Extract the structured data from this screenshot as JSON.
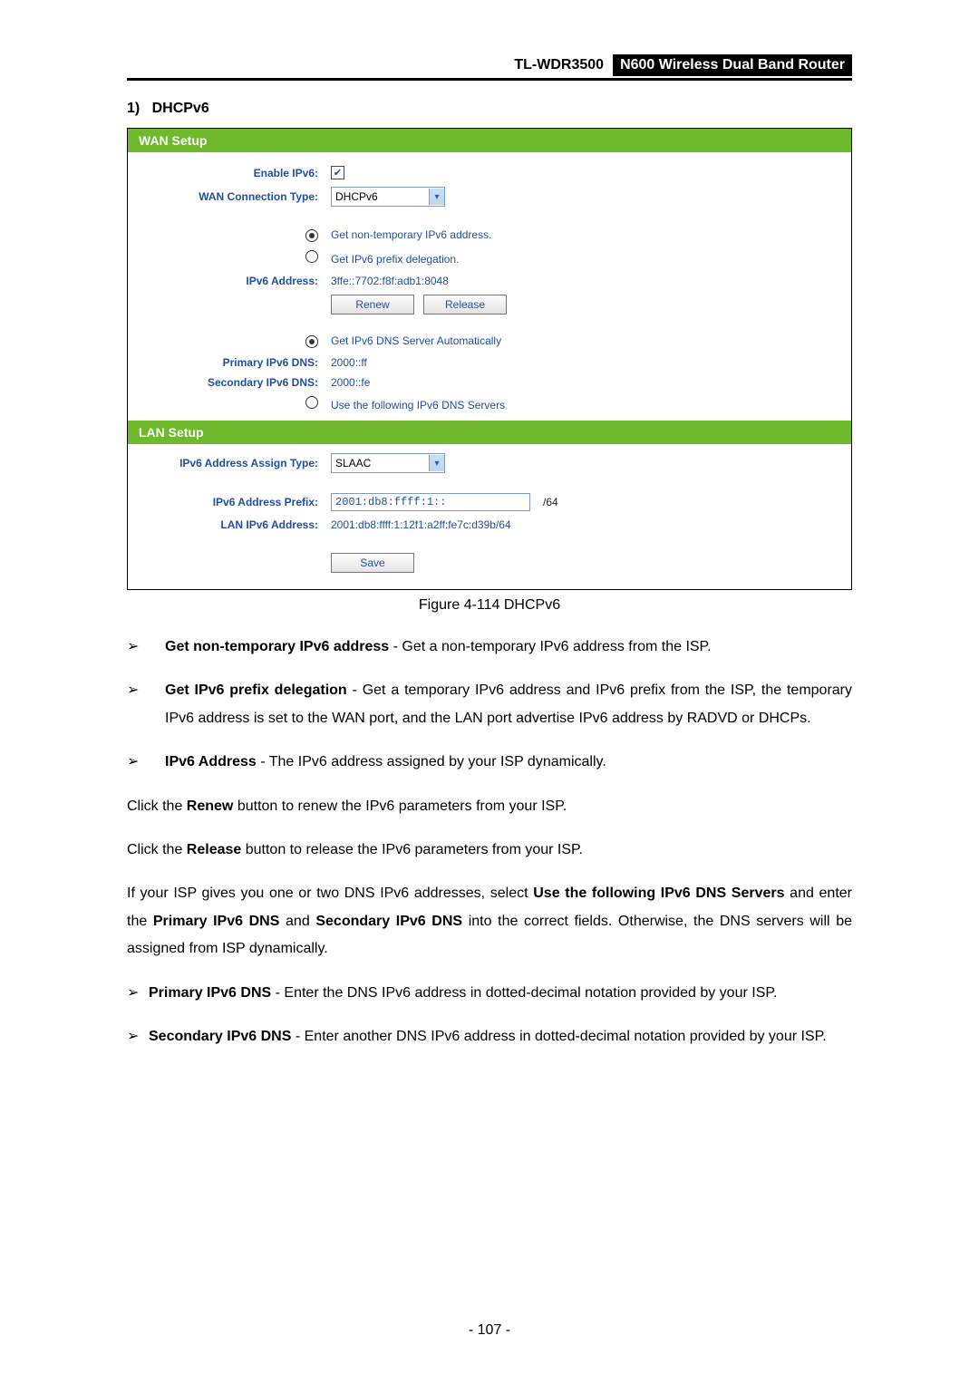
{
  "header": {
    "model": "TL-WDR3500",
    "product": "N600 Wireless Dual Band Router"
  },
  "section": {
    "number": "1)",
    "title": "DHCPv6"
  },
  "figure": {
    "wan_title": "WAN Setup",
    "lan_title": "LAN Setup",
    "rows": {
      "enable_ipv6_label": "Enable IPv6:",
      "wan_conn_label": "WAN Connection Type:",
      "wan_conn_value": "DHCPv6",
      "opt_nontemp": "Get non-temporary IPv6 address.",
      "opt_prefix": "Get IPv6 prefix delegation.",
      "ipv6_addr_label": "IPv6 Address:",
      "ipv6_addr_value": "3ffe::7702:f8f:adb1:8048",
      "renew": "Renew",
      "release": "Release",
      "opt_auto_dns": "Get IPv6 DNS Server Automatically",
      "primary_dns_label": "Primary IPv6 DNS:",
      "primary_dns_value": "2000::ff",
      "secondary_dns_label": "Secondary IPv6 DNS:",
      "secondary_dns_value": "2000::fe",
      "opt_manual_dns": "Use the following IPv6 DNS Servers",
      "assign_type_label": "IPv6 Address Assign Type:",
      "assign_type_value": "SLAAC",
      "prefix_label": "IPv6 Address Prefix:",
      "prefix_value": "2001:db8:ffff:1::",
      "prefix_suffix": "/64",
      "lan_addr_label": "LAN IPv6 Address:",
      "lan_addr_value": "2001:db8:ffff:1:12f1:a2ff:fe7c:d39b/64",
      "save": "Save"
    },
    "caption": "Figure 4-114 DHCPv6"
  },
  "bullets1": {
    "b1_strong": "Get non-temporary IPv6 address",
    "b1_rest": " - Get a non-temporary IPv6 address from the ISP.",
    "b2_strong": "Get IPv6 prefix delegation",
    "b2_rest": " - Get a temporary IPv6 address and IPv6 prefix from the ISP, the temporary IPv6 address is set to the WAN port, and the LAN port advertise IPv6 address by RADVD or DHCPs.",
    "b3_strong": "IPv6 Address",
    "b3_rest": " - The IPv6 address assigned by your ISP dynamically."
  },
  "paragraphs": {
    "renew_pre": "Click the ",
    "renew_strong": "Renew",
    "renew_post": " button to renew the IPv6 parameters from your ISP.",
    "release_pre": "Click the ",
    "release_strong": "Release",
    "release_post": " button to release the IPv6 parameters from your ISP.",
    "dns_p1_a": "If your ISP gives you one or two DNS IPv6 addresses, select ",
    "dns_p1_b": "Use the following IPv6 DNS Servers",
    "dns_p1_c": " and enter the ",
    "dns_p1_d": "Primary IPv6 DNS",
    "dns_p1_e": " and ",
    "dns_p1_f": "Secondary IPv6 DNS",
    "dns_p1_g": " into the correct fields. Otherwise, the DNS servers will be assigned from ISP dynamically."
  },
  "bullets2": {
    "b1_strong": "Primary IPv6 DNS",
    "b1_rest": " - Enter the DNS IPv6 address in dotted-decimal notation provided by your ISP.",
    "b2_strong": "Secondary IPv6 DNS",
    "b2_rest": " - Enter another DNS IPv6 address in dotted-decimal notation provided by your ISP."
  },
  "page_number": "- 107 -"
}
